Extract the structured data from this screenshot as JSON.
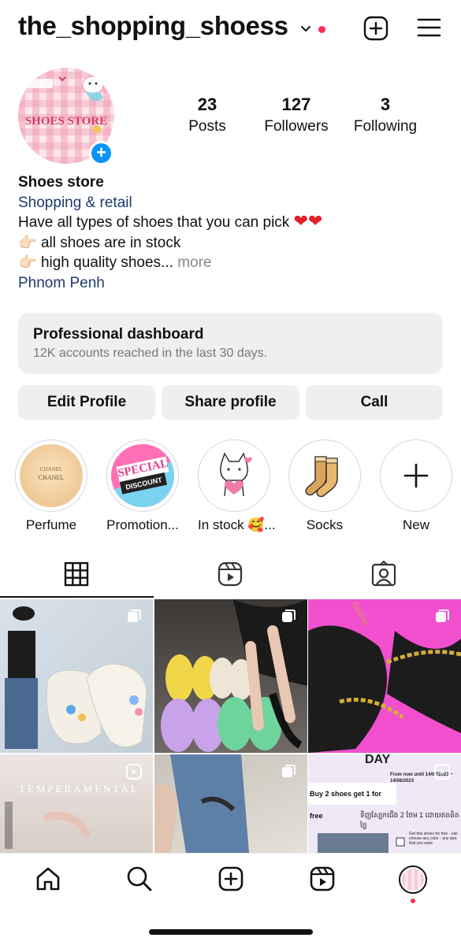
{
  "header": {
    "username": "the_shopping_shoess",
    "icons": {
      "dropdown": "chevron-down-icon",
      "notification": "red-dot",
      "create": "plus-square-icon",
      "menu": "hamburger-menu-icon"
    }
  },
  "profile": {
    "avatar_text": "SHOES STORE",
    "stats": [
      {
        "value": "23",
        "label": "Posts"
      },
      {
        "value": "127",
        "label": "Followers"
      },
      {
        "value": "3",
        "label": "Following"
      }
    ],
    "bio": {
      "name": "Shoes store",
      "category": "Shopping & retail",
      "line1": "Have all types of shoes that you can pick",
      "line2": "all shoes are in stock",
      "line3": "high quality shoes...",
      "more": "more",
      "location": "Phnom Penh"
    }
  },
  "dashboard": {
    "title": "Professional dashboard",
    "subtitle": "12K accounts reached in the last 30 days."
  },
  "buttons": {
    "edit": "Edit Profile",
    "share": "Share profile",
    "call": "Call"
  },
  "highlights": [
    {
      "label": "Perfume"
    },
    {
      "label": "Promotion..."
    },
    {
      "label": "In stock 🥰..."
    },
    {
      "label": "Socks"
    },
    {
      "label": "New"
    }
  ],
  "highlight_art": {
    "perfume_text1": "CHANEL",
    "perfume_text2": "CHANEL",
    "promo_text1": "SPECIAL",
    "promo_text2": "DISCOUNT"
  },
  "tabs": [
    "grid-icon",
    "reels-icon",
    "tagged-icon"
  ],
  "posts": {
    "p4_text": "TEMPERAMENTAL",
    "p6_title": "DAY",
    "p6_line1": "Buy 2 shoes get 1 for free",
    "p6_line2": "From now until 14/07/2023 ~ 14/08/2023",
    "p6_line3": "ទិញស្បែកជើង 2 ថែម 1 ដោយឥតគិតថ្លៃ",
    "p6_line4": "Get this shoes for free - can choose any color - any size that you want",
    "p3_brand": "fashion"
  },
  "colors": {
    "accent_blue": "#0a95f6",
    "link_blue": "#1f3b70",
    "notification_red": "#ff2d55",
    "button_gray": "#efefef"
  }
}
